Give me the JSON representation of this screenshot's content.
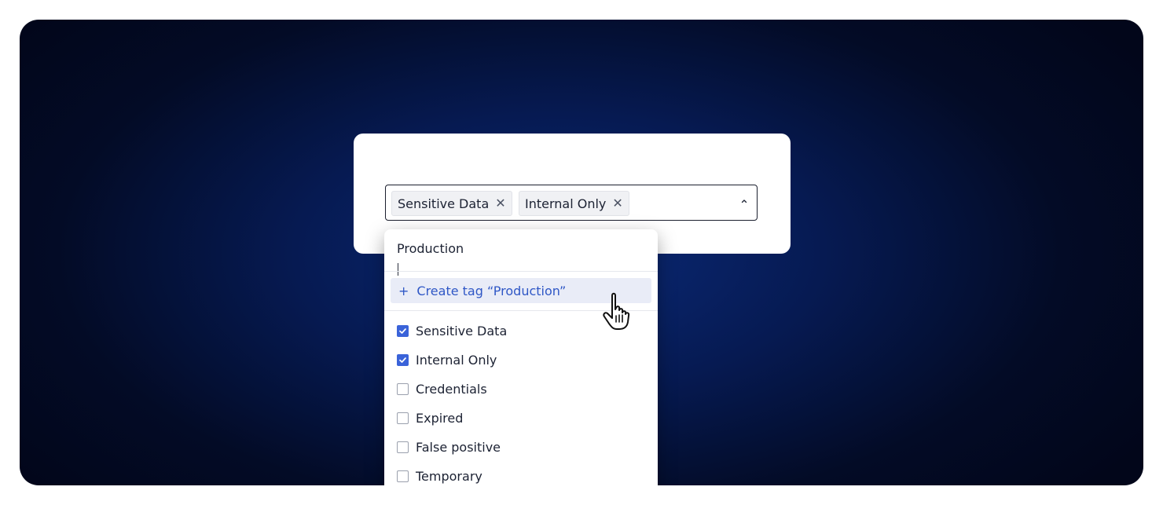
{
  "tag_select": {
    "selected_chips": [
      {
        "label": "Sensitive Data",
        "remove_symbol": "✕"
      },
      {
        "label": "Internal Only",
        "remove_symbol": "✕"
      }
    ],
    "expand_icon": "chevron-up-icon"
  },
  "dropdown": {
    "search_value": "Production",
    "create_prefix": "+",
    "create_label": "Create tag “Production”",
    "options": [
      {
        "label": "Sensitive Data",
        "checked": true
      },
      {
        "label": "Internal Only",
        "checked": true
      },
      {
        "label": "Credentials",
        "checked": false
      },
      {
        "label": "Expired",
        "checked": false
      },
      {
        "label": "False positive",
        "checked": false
      },
      {
        "label": "Temporary",
        "checked": false
      }
    ]
  },
  "colors": {
    "accent": "#3a63d9",
    "create_text": "#2f57c6",
    "create_bg": "#e9ecf7",
    "backdrop": "#061a52"
  }
}
